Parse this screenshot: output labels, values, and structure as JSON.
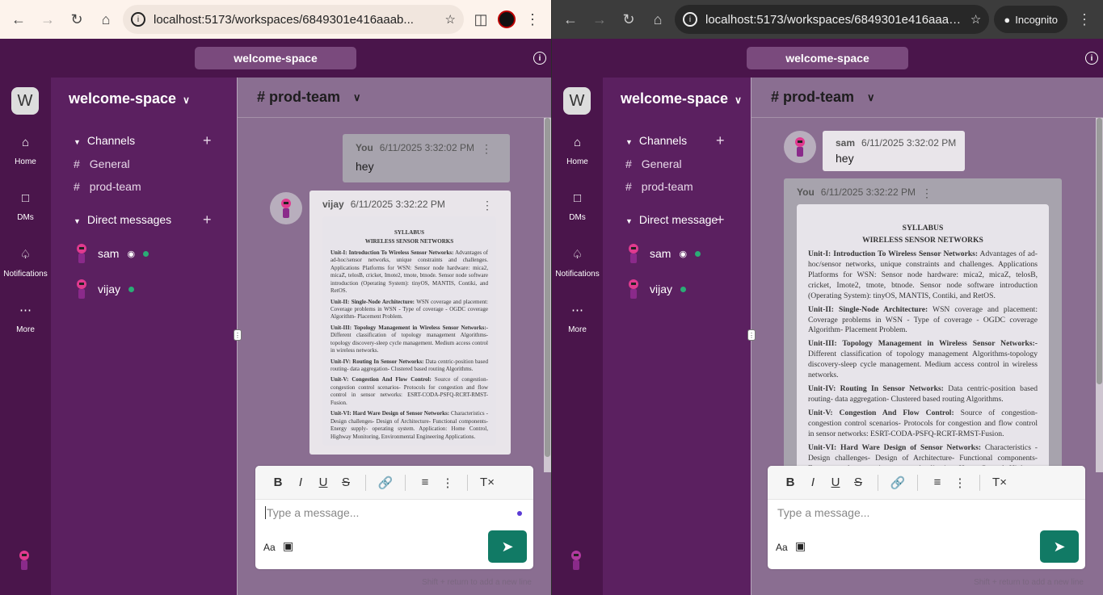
{
  "windows": [
    {
      "browser": {
        "url": "localhost:5173/workspaces/6849301e416aaab...",
        "incognito_label": ""
      },
      "topbar": {
        "workspace_search": "welcome-space"
      },
      "rail": {
        "workspace_initial": "W",
        "items": [
          "Home",
          "DMs",
          "Notifications",
          "More"
        ]
      },
      "sidebar": {
        "workspace_name": "welcome-space",
        "channels_heading": "Channels",
        "channels": [
          "General",
          "prod-team"
        ],
        "dms_heading": "Direct messages",
        "dms": [
          "sam",
          "vijay"
        ]
      },
      "channel": {
        "name": "# prod-team"
      },
      "messages": [
        {
          "author": "You",
          "time": "6/11/2025 3:32:02 PM",
          "text": "hey"
        },
        {
          "author": "vijay",
          "time": "6/11/2025 3:32:22 PM",
          "text": ""
        }
      ],
      "editor": {
        "placeholder": "Type a message...",
        "hint": "Shift + return to add a new line"
      }
    },
    {
      "browser": {
        "url": "localhost:5173/workspaces/6849301e416aaaa...",
        "incognito_label": "Incognito"
      },
      "topbar": {
        "workspace_search": "welcome-space"
      },
      "rail": {
        "workspace_initial": "W",
        "items": [
          "Home",
          "DMs",
          "Notifications",
          "More"
        ]
      },
      "sidebar": {
        "workspace_name": "welcome-space",
        "channels_heading": "Channels",
        "channels": [
          "General",
          "prod-team"
        ],
        "dms_heading": "Direct message",
        "dms": [
          "sam",
          "vijay"
        ]
      },
      "channel": {
        "name": "# prod-team"
      },
      "messages": [
        {
          "author": "sam",
          "time": "6/11/2025 3:32:02 PM",
          "text": "hey"
        },
        {
          "author": "You",
          "time": "6/11/2025 3:32:22 PM",
          "text": ""
        }
      ],
      "editor": {
        "placeholder": "Type a message...",
        "hint": "Shift + return to add a new line"
      }
    }
  ],
  "syllabus": {
    "title1": "SYLLABUS",
    "title2": "WIRELESS SENSOR NETWORKS",
    "units": [
      {
        "head": "Unit-I: Introduction To Wireless Sensor Networks:",
        "body": "Advantages of ad-hoc/sensor networks, unique constraints and challenges. Applications Platforms for WSN: Sensor node hardware: mica2, micaZ, telosB, cricket, Imote2, tmote, btnode. Sensor node software introduction (Operating System): tinyOS, MANTIS, Contiki, and RetOS."
      },
      {
        "head": "Unit-II: Single-Node Architecture:",
        "body": "WSN coverage and placement: Coverage problems in WSN - Type of coverage - OGDC coverage Algorithm- Placement Problem."
      },
      {
        "head": "Unit-III: Topology Management in Wireless Sensor Networks:-",
        "body": "Different classification of topology management Algorithms-topology discovery-sleep cycle management. Medium access control in wireless networks."
      },
      {
        "head": "Unit-IV: Routing In Sensor Networks:",
        "body": "Data centric-position based routing- data aggregation- Clustered based routing Algorithms."
      },
      {
        "head": "Unit-V: Congestion And Flow Control:",
        "body": "Source of congestion- congestion control scenarios- Protocols for congestion and flow control in sensor networks: ESRT-CODA-PSFQ-RCRT-RMST-Fusion."
      },
      {
        "head": "Unit-VI: Hard Ware Design of Sensor Networks:",
        "body": "Characteristics - Design challenges- Design of Architecture- Functional components- Energy supply- operating system. Application: Home Control, Highway Monitoring, Environmental Engineering Applications."
      }
    ]
  },
  "colors": {
    "topbar": "#4a154b",
    "sidebar": "#5b2060",
    "main": "#8a6e91",
    "send": "#117a65",
    "online": "#2bac76"
  }
}
